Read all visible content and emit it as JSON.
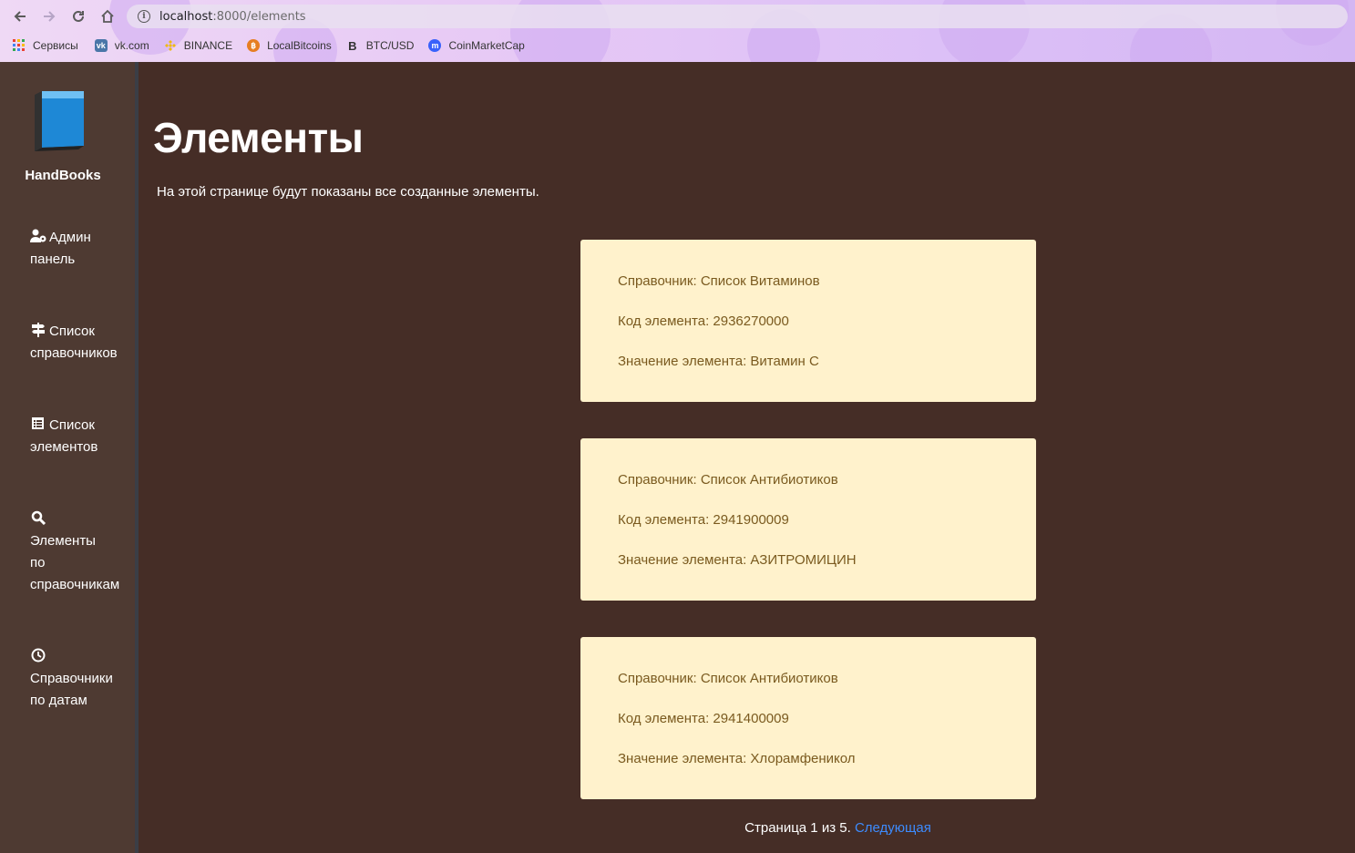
{
  "browser": {
    "url_host": "localhost",
    "url_path": ":8000/elements",
    "bookmarks": [
      {
        "label": "Сервисы",
        "icon": "apps-grid-icon"
      },
      {
        "label": "vk.com",
        "icon": "vk-icon",
        "color": "#4a76a8"
      },
      {
        "label": "BINANCE",
        "icon": "binance-icon",
        "color": "#f0b90b"
      },
      {
        "label": "LocalBitcoins",
        "icon": "localbitcoins-icon",
        "color": "#e67e22"
      },
      {
        "label": "BTC/USD",
        "icon": "bitcoin-b-icon",
        "color": "#333333"
      },
      {
        "label": "CoinMarketCap",
        "icon": "coinmarketcap-icon",
        "color": "#3861fb"
      }
    ]
  },
  "sidebar": {
    "brand": "HandBooks",
    "items": [
      {
        "line1": "Админ",
        "line2": "панель",
        "icon": "user-cog-icon"
      },
      {
        "line1": "Список",
        "line2": "справочников",
        "icon": "signs-icon"
      },
      {
        "line1": "Список",
        "line2": "элементов",
        "icon": "list-alt-icon"
      },
      {
        "line1": "Элементы",
        "line2": "по",
        "line3": "справочникам",
        "icon": "search-icon"
      },
      {
        "line1": "Справочники",
        "line2": "по датам",
        "icon": "clock-icon"
      }
    ]
  },
  "main": {
    "title": "Элементы",
    "description": "На этой странице будут показаны все созданные элементы.",
    "cards": [
      {
        "handbook": "Справочник: Список Витаминов",
        "code": "Код элемента: 2936270000",
        "value": "Значение элемента: Витамин С"
      },
      {
        "handbook": "Справочник: Список Антибиотиков",
        "code": "Код элемента: 2941900009",
        "value": "Значение элемента: АЗИТРОМИЦИН"
      },
      {
        "handbook": "Справочник: Список Антибиотиков",
        "code": "Код элемента: 2941400009",
        "value": "Значение элемента: Хлорамфеникол"
      }
    ],
    "pager": {
      "text": "Страница 1 из 5.",
      "next": "Следующая"
    }
  },
  "colors": {
    "background": "#452d26",
    "sidebar": "#4e3a32",
    "card": "#fff2cc",
    "card_text": "#7a5a1f",
    "link": "#3d8bfd"
  }
}
